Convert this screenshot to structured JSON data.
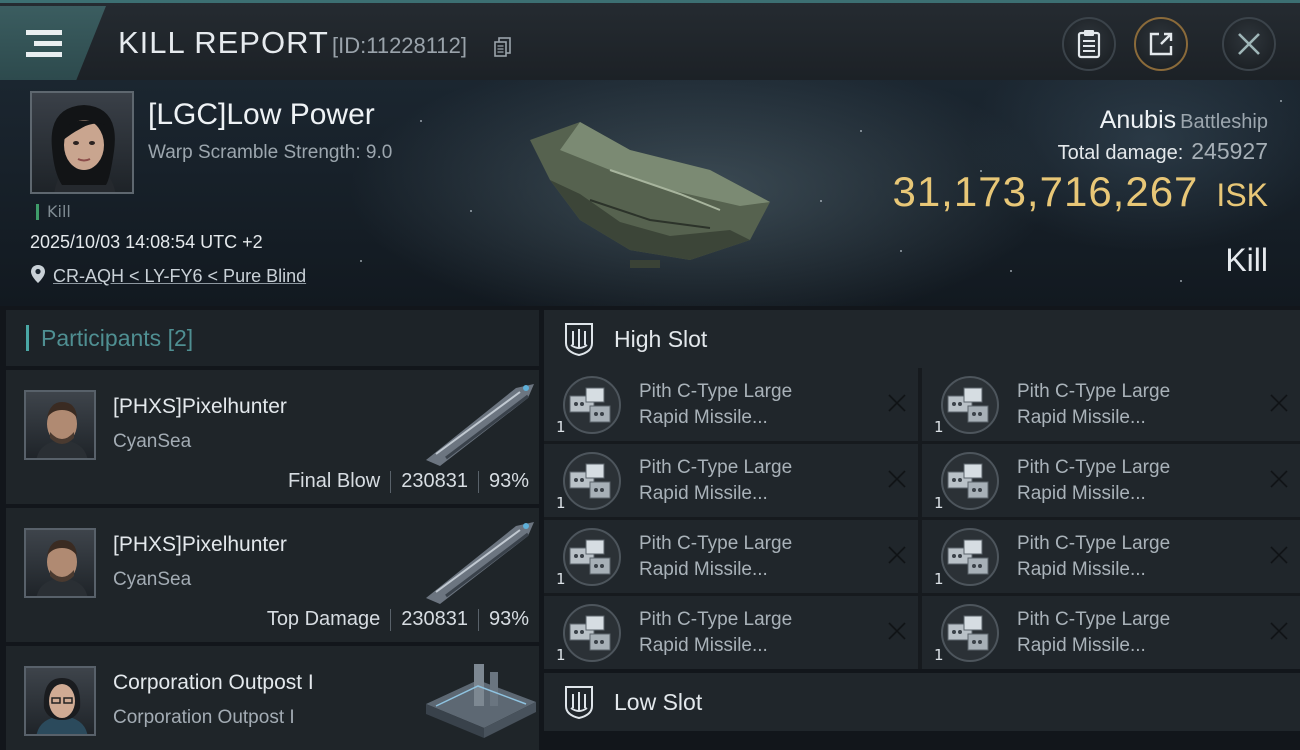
{
  "header": {
    "title": "KILL REPORT",
    "report_id": "[ID:11228112]"
  },
  "victim": {
    "name": "[LGC]Low Power",
    "warp_scramble": "Warp Scramble Strength: 9.0",
    "tag": "Kill",
    "time": "2025/10/03 14:08:54 UTC +2",
    "location": "CR-AQH < LY-FY6 < Pure Blind",
    "ship_name": "Anubis",
    "ship_class": "Battleship",
    "total_damage_label": "Total damage:",
    "total_damage": "245927",
    "isk_value": "31,173,716,267",
    "isk_unit": "ISK",
    "result": "Kill"
  },
  "participants": {
    "title": "Participants",
    "count": "[2]",
    "rows": [
      {
        "name": "[PHXS]Pixelhunter",
        "corp": "CyanSea",
        "role": "Final Blow",
        "damage": "230831",
        "percent": "93%"
      },
      {
        "name": "[PHXS]Pixelhunter",
        "corp": "CyanSea",
        "role": "Top Damage",
        "damage": "230831",
        "percent": "93%"
      },
      {
        "name": "Corporation Outpost I",
        "corp": "Corporation Outpost I"
      }
    ]
  },
  "slots": {
    "high_title": "High Slot",
    "low_title": "Low Slot",
    "high_modules": [
      {
        "line1": "Pith C-Type Large",
        "line2": "Rapid Missile...",
        "qty": "1"
      },
      {
        "line1": "Pith C-Type Large",
        "line2": "Rapid Missile...",
        "qty": "1"
      },
      {
        "line1": "Pith C-Type Large",
        "line2": "Rapid Missile...",
        "qty": "1"
      },
      {
        "line1": "Pith C-Type Large",
        "line2": "Rapid Missile...",
        "qty": "1"
      },
      {
        "line1": "Pith C-Type Large",
        "line2": "Rapid Missile...",
        "qty": "1"
      },
      {
        "line1": "Pith C-Type Large",
        "line2": "Rapid Missile...",
        "qty": "1"
      },
      {
        "line1": "Pith C-Type Large",
        "line2": "Rapid Missile...",
        "qty": "1"
      },
      {
        "line1": "Pith C-Type Large",
        "line2": "Rapid Missile...",
        "qty": "1"
      }
    ]
  },
  "icons": {
    "menu": "menu-icon",
    "copy": "copy-icon",
    "clipboard": "clipboard-icon",
    "share": "share-icon",
    "close": "close-icon",
    "location": "location-pin-icon",
    "slot": "slot-emblem-icon",
    "remove": "x-icon"
  },
  "colors": {
    "isk": "#e8c777",
    "accent": "#4aa7a5",
    "kill_tag": "#3f9c6a"
  }
}
